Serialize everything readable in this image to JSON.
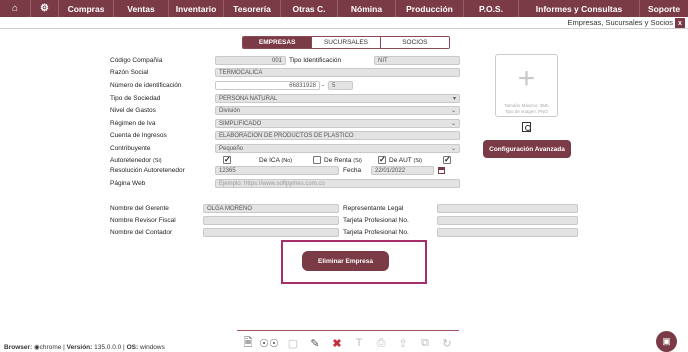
{
  "nav": {
    "home_icon": "home-icon",
    "settings_icon": "gear-icon",
    "items": [
      "Compras",
      "Ventas",
      "Inventario",
      "Tesorería",
      "Otras C.",
      "Nómina",
      "Producción",
      "P.O.S.",
      "Informes y Consultas",
      "Soporte"
    ]
  },
  "window": {
    "title": "Empresas, Sucursales y Socios",
    "close": "x"
  },
  "tabs": [
    "EMPRESAS",
    "SUCURSALES",
    "SOCIOS"
  ],
  "form": {
    "codigo_label": "Código Compañía",
    "codigo_value": "001",
    "tipo_id_label": "Tipo Identificación",
    "tipo_id_value": "NIT",
    "razon_label": "Razón Social",
    "razon_value": "TERMOCALICA",
    "numero_label": "Número de identificación",
    "numero_value": "66831928",
    "dv_sep": "-",
    "dv_value": "5",
    "tipo_soc_label": "Tipo de Sociedad",
    "tipo_soc_value": "PERSONA NATURAL",
    "nivel_label": "Nivel de Gastos",
    "nivel_value": "División",
    "regimen_label": "Régimen de Iva",
    "regimen_value": "SIMPLIFICADO",
    "cuenta_label": "Cuenta de Ingresos",
    "cuenta_value": "ELABORACION DE PRODUCTOS DE PLASTICO",
    "contrib_label": "Contribuyente",
    "contrib_value": "Pequeño",
    "autoret_label": "Autoretenedor",
    "autoret_suffix": "(Si)",
    "ica_label": "De ICA",
    "ica_suffix": "(No)",
    "renta_label": "De Renta",
    "renta_suffix": "(Si)",
    "aut_label": "De AUT",
    "aut_suffix": "(Si)",
    "resol_label": "Resolución Autoretenedor",
    "resol_value": "12365",
    "fecha_label": "Fecha",
    "fecha_value": "22/01/2022",
    "web_label": "Página Web",
    "web_placeholder": "Ejemplo: https://www.softpymes.com.co",
    "gerente_label": "Nombre del Gerente",
    "gerente_value": "OLGA MORENO",
    "rep_label": "Representante Legal",
    "revisor_label": "Nombre Revisor Fiscal",
    "tarjeta1_label": "Tarjeta Profesional No.",
    "contador_label": "Nombre del Contador",
    "tarjeta2_label": "Tarjeta Profesional No."
  },
  "image": {
    "note_line1": "Tamaño Máximo: 3Mb",
    "note_line2": "Tipo de imagen: PNG"
  },
  "buttons": {
    "config": "Configuración Avanzada",
    "delete": "Eliminar Empresa"
  },
  "checks": {
    "autoret": true,
    "ica": true,
    "renta": false,
    "aut": true,
    "extra": true
  },
  "footer": {
    "browser_label": "Browser:",
    "browser_value": "chrome",
    "version_label": "Versión:",
    "version_value": "135.0.0.0",
    "os_label": "OS:",
    "os_value": "windows"
  },
  "colors": {
    "primary": "#7a3b46",
    "highlight": "#a3306b"
  }
}
